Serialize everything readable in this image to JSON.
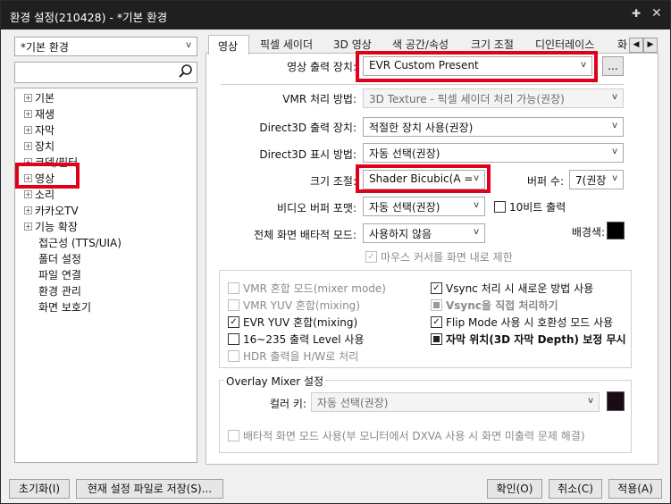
{
  "window": {
    "title": "환경 설정(210428) - *기본 환경"
  },
  "profile": {
    "selected": "*기본 환경"
  },
  "search": {
    "value": ""
  },
  "tree": [
    "기본",
    "재생",
    "자막",
    "장치",
    "코덱/필터",
    "영상",
    "소리",
    "카카오TV",
    "기능 확장",
    "접근성 (TTS/UIA)",
    "폴더 설정",
    "파일 연결",
    "환경 관리",
    "화면 보호기"
  ],
  "tabs": [
    "영상",
    "픽셀 세이더",
    "3D 영상",
    "색 공간/속성",
    "크기 조절",
    "디인터레이스",
    "화"
  ],
  "video": {
    "output_label": "영상 출력 장치:",
    "output_value": "EVR Custom Present",
    "output_more": "...",
    "vmr_label": "VMR 처리 방법:",
    "vmr_value": "3D Texture - 픽셀 세이더 처리 가능(권장)",
    "d3d_output_label": "Direct3D 출력 장치:",
    "d3d_output_value": "적절한 장치 사용(권장)",
    "d3d_display_label": "Direct3D 표시 방법:",
    "d3d_display_value": "자동 선택(권장)",
    "resize_label": "크기 조절:",
    "resize_value": "Shader Bicubic(A =",
    "buffer_label": "버퍼 수:",
    "buffer_value": "7(권장",
    "vbuf_format_label": "비디오 버퍼 포맷:",
    "vbuf_format_value": "자동 선택(권장)",
    "tenbit_label": "10비트 출력",
    "fullscreen_label": "전체 화면 배타적 모드:",
    "fullscreen_value": "사용하지 않음",
    "bgcolor_label": "배경색:",
    "bgcolor": "#000000",
    "mouse_cursor_label": "마우스 커서를 화면 내로 제한"
  },
  "options_left": [
    "VMR 혼합 모드(mixer mode)",
    "VMR YUV 혼합(mixing)",
    "EVR YUV 혼합(mixing)",
    "16~235 출력 Level 사용",
    "HDR 출력을 H/W로 처리"
  ],
  "options_right": [
    "Vsync 처리 시 새로운 방법 사용",
    "Vsync을 직접 처리하기",
    "Flip Mode 사용 시 호환성 모드 사용",
    "자막 위치(3D 자막 Depth) 보정 무시"
  ],
  "overlay": {
    "group_label": "Overlay Mixer 설정",
    "color_key_label": "컬러 키:",
    "color_key_value": "자동 선택(권장)",
    "color_key_swatch": "#1a0a14",
    "exclusive_label": "배타적 화면 모드 사용(부 모니터에서 DXVA 사용 시 화면 미출력 문제 해결)"
  },
  "buttons": {
    "reset": "초기화(I)",
    "save_file": "현재 설정 파일로 저장(S)...",
    "ok": "확인(O)",
    "cancel": "취소(C)",
    "apply": "적용(A)"
  },
  "highlight_color": "#e0001b"
}
